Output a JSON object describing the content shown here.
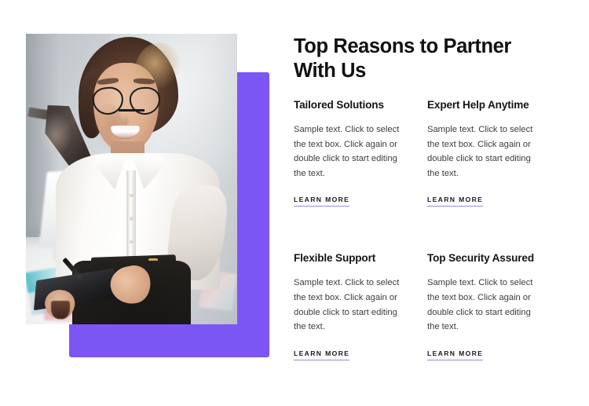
{
  "theme": {
    "accent_purple": "#7c56f4",
    "underline_purple": "#9b86e2",
    "heading_color": "#111114",
    "body_color": "#3c3c42",
    "page_background": "#ffffff"
  },
  "hero": {
    "headline": "Top Reasons to Partner With Us",
    "image_alt": "Smiling businesswoman with glasses holding a tablet in an office"
  },
  "cards": [
    {
      "title": "Tailored Solutions",
      "body": "Sample text. Click to select the text box. Click again or double click to start editing the text.",
      "link_label": "LEARN MORE"
    },
    {
      "title": "Expert Help Anytime",
      "body": "Sample text. Click to select the text box. Click again or double click to start editing the text.",
      "link_label": "LEARN MORE"
    },
    {
      "title": "Flexible Support",
      "body": "Sample text. Click to select the text box. Click again or double click to start editing the text.",
      "link_label": "LEARN MORE"
    },
    {
      "title": "Top Security Assured",
      "body": "Sample text. Click to select the text box. Click again or double click to start editing the text.",
      "link_label": "LEARN MORE"
    }
  ]
}
